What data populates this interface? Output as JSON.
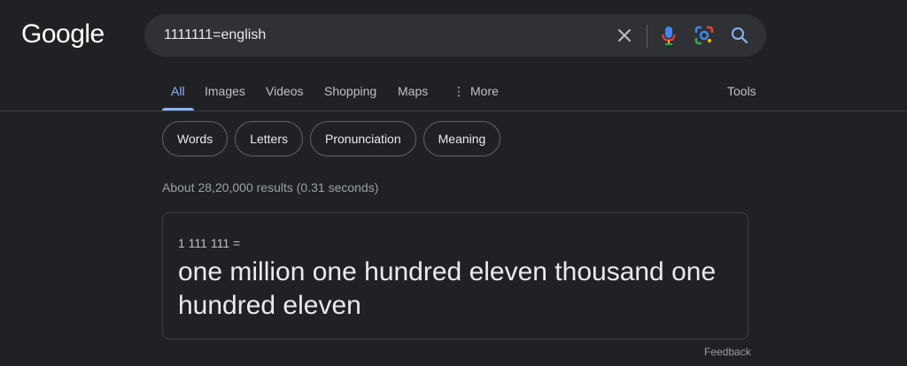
{
  "header": {
    "logo_text": "Google",
    "search_query": "1111111=english"
  },
  "icons": {
    "clear": "close-icon",
    "mic": "microphone-icon",
    "lens": "lens-icon",
    "search": "search-icon"
  },
  "tabs": [
    {
      "label": "All",
      "active": true
    },
    {
      "label": "Images"
    },
    {
      "label": "Videos"
    },
    {
      "label": "Shopping"
    },
    {
      "label": "Maps"
    },
    {
      "label": "More",
      "icon": "more-vert-icon"
    }
  ],
  "tools_label": "Tools",
  "chips": [
    "Words",
    "Letters",
    "Pronunciation",
    "Meaning"
  ],
  "result_stats": "About 28,20,000 results (0.31 seconds)",
  "calculator": {
    "equation": "1 111 111 =",
    "result": "one million one hundred eleven thousand one hundred eleven"
  },
  "feedback_label": "Feedback",
  "colors": {
    "background": "#202124",
    "accent": "#8ab4f8",
    "searchbar": "#303134"
  }
}
